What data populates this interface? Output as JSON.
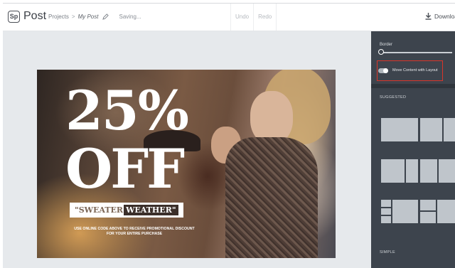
{
  "header": {
    "logo_text": "Sp",
    "app_title": "Post",
    "breadcrumb_projects": "Projects",
    "breadcrumb_separator": ">",
    "breadcrumb_current": "My Post",
    "saving_status": "Saving...",
    "undo_label": "Undo",
    "redo_label": "Redo",
    "download_label": "Download"
  },
  "poster": {
    "headline_percent": "25%",
    "headline_off": "OFF",
    "code_left": "\"SWEATER",
    "code_right": "WEATHER\"",
    "promo_line1": "USE ONLINE CODE ABOVE TO RECEIVE PROMOTIONAL DISCOUNT",
    "promo_line2": "FOR YOUR ENTIRE PURCHASE"
  },
  "panel": {
    "border_label": "Border",
    "toggle_label": "Move Content with Layout",
    "toggle_on": true,
    "suggested_label": "SUGGESTED",
    "simple_label": "SIMPLE"
  },
  "colors": {
    "panel_bg": "#3d444d",
    "highlight_border": "#d9352a",
    "canvas_bg": "#e6e9ec"
  }
}
